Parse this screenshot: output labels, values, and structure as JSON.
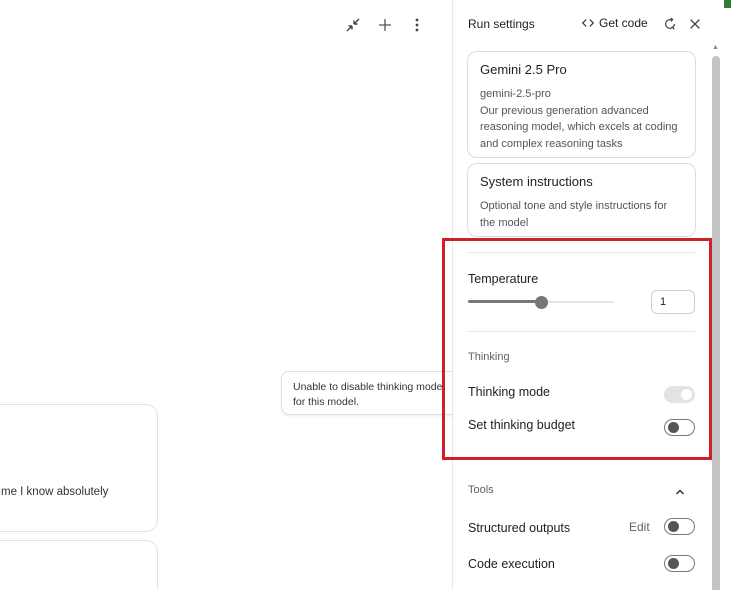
{
  "main": {
    "chat_snippet": "me I know absolutely",
    "tooltip": "Unable to disable thinking mode\nfor this model.",
    "actions": [
      "compress-icon",
      "plus-icon",
      "more-vert-icon"
    ]
  },
  "panel": {
    "title": "Run settings",
    "get_code_label": "Get code",
    "model": {
      "name": "Gemini 2.5 Pro",
      "id": "gemini-2.5-pro",
      "description": "Our previous generation advanced reasoning model, which excels at coding and complex reasoning tasks"
    },
    "system_instructions": {
      "title": "System instructions",
      "placeholder": "Optional tone and style instructions for the model"
    },
    "temperature": {
      "label": "Temperature",
      "value": "1",
      "fraction": 0.5
    },
    "thinking": {
      "section": "Thinking",
      "mode_label": "Thinking mode",
      "mode_on": true,
      "mode_disabled": true,
      "budget_label": "Set thinking budget",
      "budget_on": false
    },
    "tools": {
      "section": "Tools",
      "structured_outputs_label": "Structured outputs",
      "edit_label": "Edit",
      "code_execution_label": "Code execution"
    }
  },
  "colors": {
    "highlight": "#d11f2a",
    "accent_green": "#2e7d32"
  }
}
